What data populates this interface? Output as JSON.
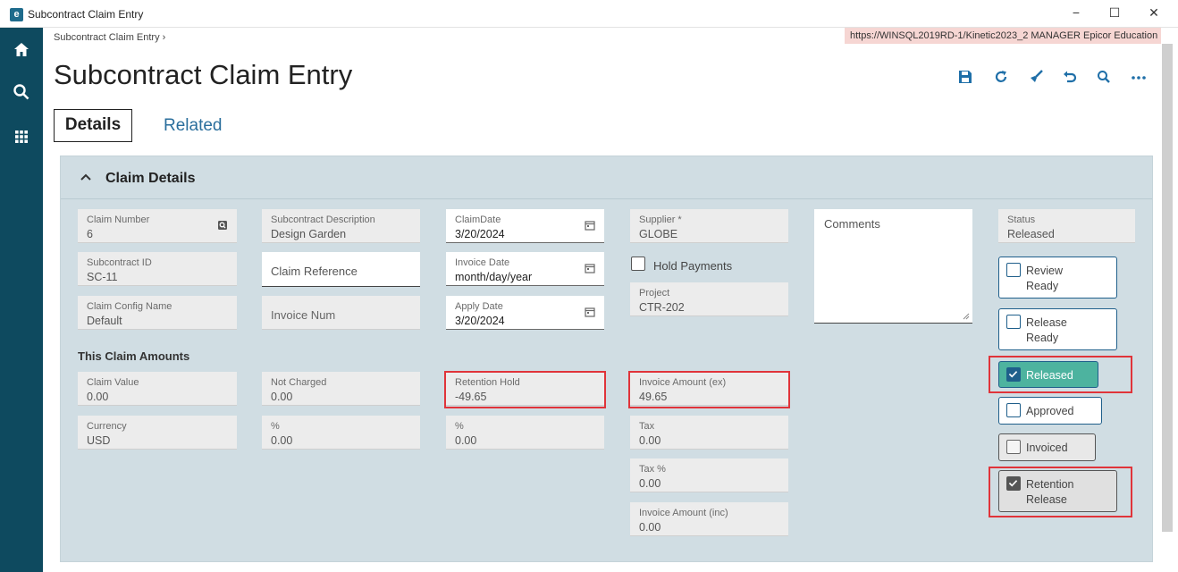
{
  "window": {
    "title": "Subcontract Claim Entry",
    "minimize": "−",
    "maximize": "☐",
    "close": "✕"
  },
  "breadcrumb": "Subcontract Claim Entry  ›",
  "connection": "https://WINSQL2019RD-1/Kinetic2023_2  MANAGER  Epicor Education",
  "page_title": "Subcontract Claim Entry",
  "tabs": {
    "details": "Details",
    "related": "Related"
  },
  "panel": {
    "title": "Claim Details"
  },
  "fields": {
    "claim_number": {
      "label": "Claim Number",
      "value": "6"
    },
    "subcontract_id": {
      "label": "Subcontract ID",
      "value": "SC-11"
    },
    "claim_config_name": {
      "label": "Claim Config Name",
      "value": "Default"
    },
    "subcontract_description": {
      "label": "Subcontract Description",
      "value": "Design Garden"
    },
    "claim_reference": {
      "placeholder": "Claim Reference"
    },
    "invoice_num": {
      "placeholder": "Invoice Num"
    },
    "claim_date": {
      "label": "ClaimDate",
      "value": "3/20/2024"
    },
    "invoice_date": {
      "label": "Invoice Date",
      "value": "month/day/year"
    },
    "apply_date": {
      "label": "Apply Date",
      "value": "3/20/2024"
    },
    "supplier": {
      "label": "Supplier *",
      "value": "GLOBE"
    },
    "hold_payments": {
      "label": "Hold Payments"
    },
    "project": {
      "label": "Project",
      "value": "CTR-202"
    },
    "comments": {
      "placeholder": "Comments"
    },
    "status": {
      "label": "Status",
      "value": "Released"
    }
  },
  "amounts": {
    "section_label": "This Claim Amounts",
    "claim_value": {
      "label": "Claim Value",
      "value": "0.00"
    },
    "currency": {
      "label": "Currency",
      "value": "USD"
    },
    "not_charged": {
      "label": "Not Charged",
      "value": "0.00"
    },
    "not_charged_pct": {
      "label": "%",
      "value": "0.00"
    },
    "retention_hold": {
      "label": "Retention Hold",
      "value": "-49.65"
    },
    "retention_pct": {
      "label": "%",
      "value": "0.00"
    },
    "invoice_amount_ex": {
      "label": "Invoice Amount (ex)",
      "value": "49.65"
    },
    "tax": {
      "label": "Tax",
      "value": "0.00"
    },
    "tax_pct": {
      "label": "Tax %",
      "value": "0.00"
    },
    "invoice_amount_inc": {
      "label": "Invoice Amount (inc)",
      "value": "0.00"
    }
  },
  "status_buttons": {
    "review_ready": {
      "line1": "Review",
      "line2": "Ready"
    },
    "release_ready": {
      "line1": "Release",
      "line2": "Ready"
    },
    "released": {
      "label": "Released"
    },
    "approved": {
      "label": "Approved"
    },
    "invoiced": {
      "label": "Invoiced"
    },
    "retention_release": {
      "line1": "Retention",
      "line2": "Release"
    }
  },
  "colors": {
    "sidebar": "#0e4a5f",
    "accent": "#1f6fa8",
    "panel": "#d0dde3",
    "highlight": "#e0343a",
    "released": "#4db39f"
  }
}
